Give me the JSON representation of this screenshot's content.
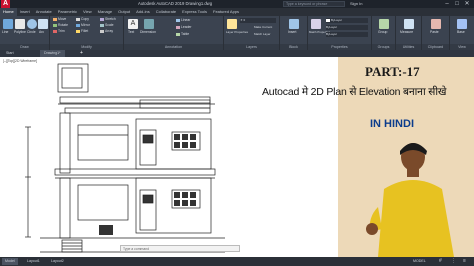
{
  "titlebar": {
    "title": "Autodesk AutoCAD 2019   Drawing1.dwg",
    "search_placeholder": "Type a keyword or phrase",
    "signin": "Sign In",
    "window_buttons": [
      "–",
      "□",
      "✕"
    ]
  },
  "tabs": [
    "Home",
    "Insert",
    "Annotate",
    "Parametric",
    "View",
    "Manage",
    "Output",
    "Add-ins",
    "Collaborate",
    "Express Tools",
    "Featured Apps"
  ],
  "active_tab": "Home",
  "ribbon": {
    "draw": {
      "label": "Draw",
      "items": [
        "Line",
        "Polyline",
        "Circle",
        "Arc"
      ]
    },
    "modify": {
      "label": "Modify",
      "items": [
        "Move",
        "Rotate",
        "Trim",
        "Copy",
        "Mirror",
        "Fillet",
        "Stretch",
        "Scale",
        "Array"
      ]
    },
    "annotation": {
      "label": "Annotation",
      "items": [
        "Text",
        "Dimension",
        "Linear",
        "Leader",
        "Table"
      ]
    },
    "layers": {
      "label": "Layers",
      "items": [
        "Layer Properties",
        "Make Current",
        "Match Layer"
      ]
    },
    "block": {
      "label": "Block",
      "items": [
        "Insert"
      ]
    },
    "properties": {
      "label": "Properties",
      "items": [
        "ByLayer",
        "ByLayer",
        "ByLayer",
        "Match Properties"
      ]
    },
    "groups": {
      "label": "Groups",
      "items": [
        "Group"
      ]
    },
    "utilities": {
      "label": "Utilities",
      "items": [
        "Measure"
      ]
    },
    "clipboard": {
      "label": "Clipboard",
      "items": [
        "Paste"
      ]
    },
    "view": {
      "label": "View",
      "items": [
        "Base"
      ]
    }
  },
  "doc_tabs": [
    "Start",
    "Drawing1*"
  ],
  "viewport_label": "[–][Top][2D Wireframe]",
  "thumbnail": {
    "part": "PART:-17",
    "headline": "Autocad मे 2D Plan से Elevation बनाना सीखे",
    "language": "IN HINDI"
  },
  "command_placeholder": "Type a command",
  "status_tabs": [
    "Model",
    "Layout1",
    "Layout2"
  ],
  "status_right": "MODEL",
  "colors": {
    "titlebar": "#1e232b",
    "ribbon": "#3b4350",
    "thumb_bg": "#edd9b8",
    "accent_red": "#c8102e",
    "headline_blue": "#0b3c8c"
  }
}
